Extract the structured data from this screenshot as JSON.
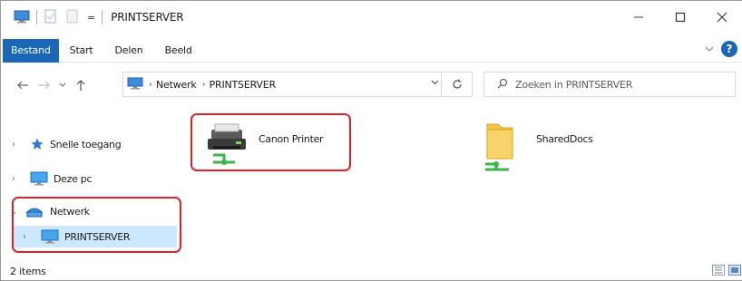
{
  "titlebar": {
    "title": "PRINTSERVER",
    "qat_dropdown": "="
  },
  "ribbon": {
    "tabs": [
      {
        "label": "Bestand",
        "active": true
      },
      {
        "label": "Start",
        "active": false
      },
      {
        "label": "Delen",
        "active": false
      },
      {
        "label": "Beeld",
        "active": false
      }
    ]
  },
  "address": {
    "segments": [
      "Netwerk",
      "PRINTSERVER"
    ]
  },
  "search": {
    "placeholder": "Zoeken in PRINTSERVER"
  },
  "navpane": {
    "items": [
      {
        "label": "Snelle toegang",
        "icon": "star-icon",
        "expanded": false
      },
      {
        "label": "Deze pc",
        "icon": "monitor-icon",
        "expanded": false
      },
      {
        "label": "Netwerk",
        "icon": "network-icon",
        "expanded": true
      },
      {
        "label": "PRINTSERVER",
        "icon": "monitor-icon",
        "expanded": false,
        "selected": true
      }
    ]
  },
  "content": {
    "items": [
      {
        "label": "Canon Printer",
        "icon": "shared-printer-icon"
      },
      {
        "label": "SharedDocs",
        "icon": "shared-folder-icon"
      }
    ]
  },
  "status": {
    "item_count": "2 items"
  },
  "colors": {
    "accent": "#1a66b8",
    "selection": "#cce8ff",
    "highlight_border": "#e0202a"
  }
}
